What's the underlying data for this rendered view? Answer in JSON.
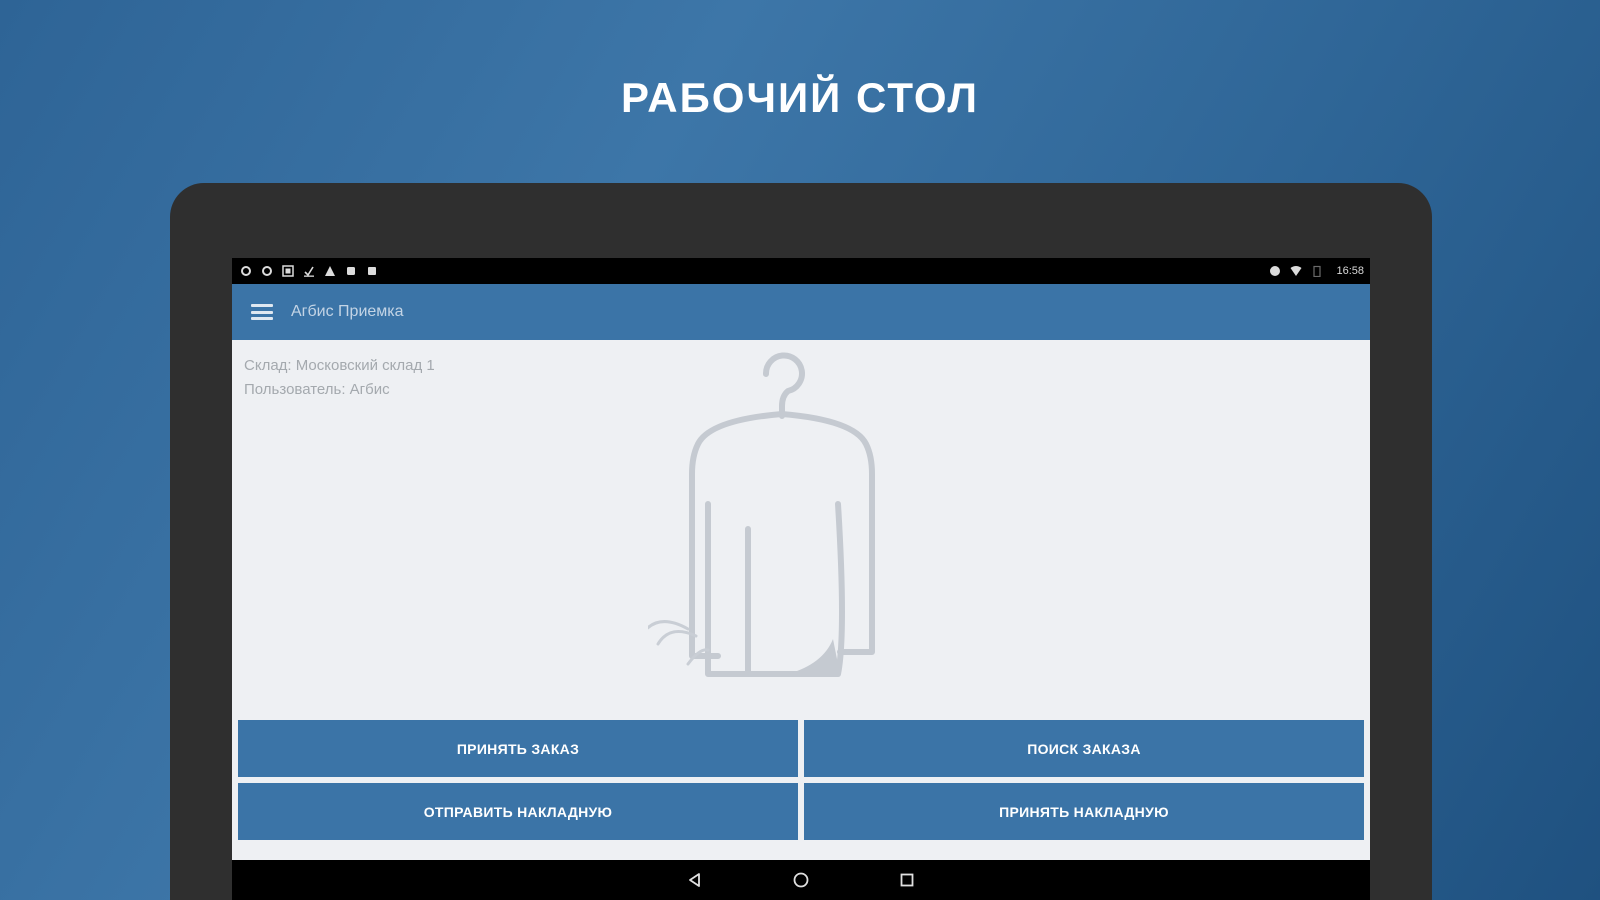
{
  "promo": {
    "headline": "РАБОЧИЙ СТОЛ"
  },
  "status_bar": {
    "time": "16:58",
    "left_icons": [
      "settings-icon",
      "settings-icon",
      "image-icon",
      "download-icon",
      "warning-icon",
      "square-icon",
      "square-icon"
    ],
    "right_icons": [
      "alarm-icon",
      "wifi-icon",
      "battery-icon"
    ]
  },
  "app_bar": {
    "title": "Агбис Приемка"
  },
  "info": {
    "warehouse": "Склад: Московский склад 1",
    "user": "Пользователь: Агбис"
  },
  "actions": {
    "accept_order": "ПРИНЯТЬ ЗАКАЗ",
    "search_order": "ПОИСК ЗАКАЗА",
    "send_invoice": "ОТПРАВИТЬ НАКЛАДНУЮ",
    "accept_invoice": "ПРИНЯТЬ НАКЛАДНУЮ"
  },
  "colors": {
    "background": "#2f6697",
    "primary": "#3b74a7",
    "tablet_bezel": "#2f2f2f",
    "screen_bg": "#eef0f3",
    "illustration": "#c5cad1"
  }
}
